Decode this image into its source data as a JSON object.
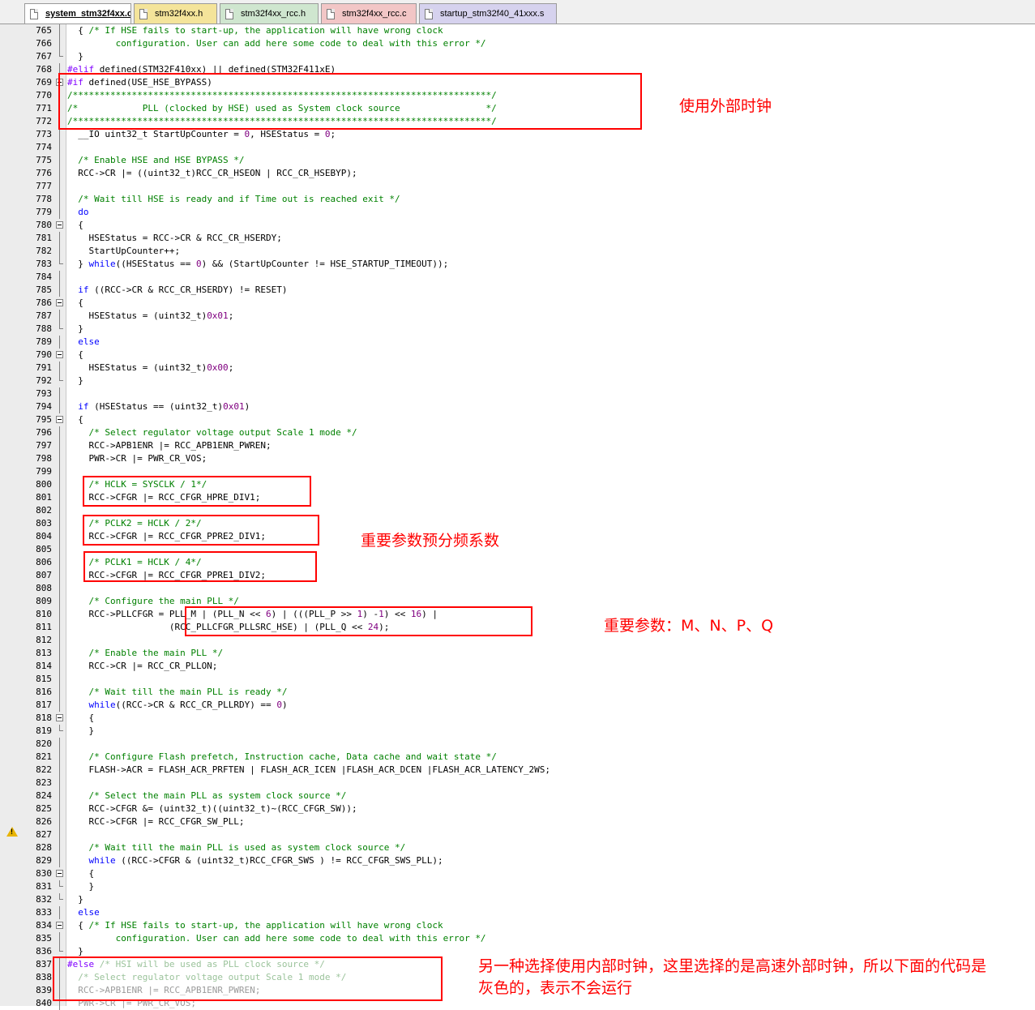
{
  "tabs": [
    {
      "label": "system_stm32f4xx.c",
      "color": "#ffffff",
      "active": true
    },
    {
      "label": "stm32f4xx.h",
      "color": "#f4e49a",
      "active": false
    },
    {
      "label": "stm32f4xx_rcc.h",
      "color": "#cfe6cf",
      "active": false
    },
    {
      "label": "stm32f4xx_rcc.c",
      "color": "#f2c6c6",
      "active": false
    },
    {
      "label": "startup_stm32f40_41xxx.s",
      "color": "#d6d2ee",
      "active": false
    }
  ],
  "code_lines": [
    {
      "num": "765",
      "html": "  { <span class='c'>/* If HSE fails to start-up, the application will have wrong clock</span>"
    },
    {
      "num": "766",
      "html": "<span class='c'>         configuration. User can add here some code to deal with this error */</span>"
    },
    {
      "num": "767",
      "html": "  }"
    },
    {
      "num": "768",
      "html": "<span class='pp'>#elif</span> defined(STM32F410xx) || defined(STM32F411xE)"
    },
    {
      "num": "769",
      "html": "<span class='pp'>#if</span> defined(USE_HSE_BYPASS)"
    },
    {
      "num": "770",
      "html": "<span class='c'>/******************************************************************************/</span>"
    },
    {
      "num": "771",
      "html": "<span class='c'>/*            PLL (clocked by HSE) used as System clock source                */</span>"
    },
    {
      "num": "772",
      "html": "<span class='c'>/******************************************************************************/</span>"
    },
    {
      "num": "773",
      "html": "  __IO uint32_t StartUpCounter = <span class='n'>0</span>, HSEStatus = <span class='n'>0</span>;"
    },
    {
      "num": "774",
      "html": ""
    },
    {
      "num": "775",
      "html": "  <span class='c'>/* Enable HSE and HSE BYPASS */</span>"
    },
    {
      "num": "776",
      "html": "  RCC-&gt;CR |= ((uint32_t)RCC_CR_HSEON | RCC_CR_HSEBYP);"
    },
    {
      "num": "777",
      "html": ""
    },
    {
      "num": "778",
      "html": "  <span class='c'>/* Wait till HSE is ready and if Time out is reached exit */</span>"
    },
    {
      "num": "779",
      "html": "  <span class='k'>do</span>"
    },
    {
      "num": "780",
      "html": "  {"
    },
    {
      "num": "781",
      "html": "    HSEStatus = RCC-&gt;CR &amp; RCC_CR_HSERDY;"
    },
    {
      "num": "782",
      "html": "    StartUpCounter++;"
    },
    {
      "num": "783",
      "html": "  } <span class='k'>while</span>((HSEStatus == <span class='n'>0</span>) &amp;&amp; (StartUpCounter != HSE_STARTUP_TIMEOUT));"
    },
    {
      "num": "784",
      "html": ""
    },
    {
      "num": "785",
      "html": "  <span class='k'>if</span> ((RCC-&gt;CR &amp; RCC_CR_HSERDY) != RESET)"
    },
    {
      "num": "786",
      "html": "  {"
    },
    {
      "num": "787",
      "html": "    HSEStatus = (uint32_t)<span class='n'>0x01</span>;"
    },
    {
      "num": "788",
      "html": "  }"
    },
    {
      "num": "789",
      "html": "  <span class='k'>else</span>"
    },
    {
      "num": "790",
      "html": "  {"
    },
    {
      "num": "791",
      "html": "    HSEStatus = (uint32_t)<span class='n'>0x00</span>;"
    },
    {
      "num": "792",
      "html": "  }"
    },
    {
      "num": "793",
      "html": ""
    },
    {
      "num": "794",
      "html": "  <span class='k'>if</span> (HSEStatus == (uint32_t)<span class='n'>0x01</span>)"
    },
    {
      "num": "795",
      "html": "  {"
    },
    {
      "num": "796",
      "html": "    <span class='c'>/* Select regulator voltage output Scale 1 mode */</span>"
    },
    {
      "num": "797",
      "html": "    RCC-&gt;APB1ENR |= RCC_APB1ENR_PWREN;"
    },
    {
      "num": "798",
      "html": "    PWR-&gt;CR |= PWR_CR_VOS;"
    },
    {
      "num": "799",
      "html": ""
    },
    {
      "num": "800",
      "html": "    <span class='c'>/* HCLK = SYSCLK / 1*/</span>"
    },
    {
      "num": "801",
      "html": "    RCC-&gt;CFGR |= RCC_CFGR_HPRE_DIV1;"
    },
    {
      "num": "802",
      "html": ""
    },
    {
      "num": "803",
      "html": "    <span class='c'>/* PCLK2 = HCLK / 2*/</span>"
    },
    {
      "num": "804",
      "html": "    RCC-&gt;CFGR |= RCC_CFGR_PPRE2_DIV1;"
    },
    {
      "num": "805",
      "html": ""
    },
    {
      "num": "806",
      "html": "    <span class='c'>/* PCLK1 = HCLK / 4*/</span>"
    },
    {
      "num": "807",
      "html": "    RCC-&gt;CFGR |= RCC_CFGR_PPRE1_DIV2;"
    },
    {
      "num": "808",
      "html": ""
    },
    {
      "num": "809",
      "html": "    <span class='c'>/* Configure the main PLL */</span>"
    },
    {
      "num": "810",
      "html": "    RCC-&gt;PLLCFGR = PLL_M | (PLL_N &lt;&lt; <span class='n'>6</span>) | (((PLL_P &gt;&gt; <span class='n'>1</span>) -<span class='n'>1</span>) &lt;&lt; <span class='n'>16</span>) |"
    },
    {
      "num": "811",
      "html": "                   (RCC_PLLCFGR_PLLSRC_HSE) | (PLL_Q &lt;&lt; <span class='n'>24</span>);"
    },
    {
      "num": "812",
      "html": ""
    },
    {
      "num": "813",
      "html": "    <span class='c'>/* Enable the main PLL */</span>"
    },
    {
      "num": "814",
      "html": "    RCC-&gt;CR |= RCC_CR_PLLON;"
    },
    {
      "num": "815",
      "html": ""
    },
    {
      "num": "816",
      "html": "    <span class='c'>/* Wait till the main PLL is ready */</span>"
    },
    {
      "num": "817",
      "html": "    <span class='k'>while</span>((RCC-&gt;CR &amp; RCC_CR_PLLRDY) == <span class='n'>0</span>)"
    },
    {
      "num": "818",
      "html": "    {"
    },
    {
      "num": "819",
      "html": "    }"
    },
    {
      "num": "820",
      "html": ""
    },
    {
      "num": "821",
      "html": "    <span class='c'>/* Configure Flash prefetch, Instruction cache, Data cache and wait state */</span>"
    },
    {
      "num": "822",
      "html": "    FLASH-&gt;ACR = FLASH_ACR_PRFTEN | FLASH_ACR_ICEN |FLASH_ACR_DCEN |FLASH_ACR_LATENCY_2WS;"
    },
    {
      "num": "823",
      "html": ""
    },
    {
      "num": "824",
      "html": "    <span class='c'>/* Select the main PLL as system clock source */</span>"
    },
    {
      "num": "825",
      "html": "    RCC-&gt;CFGR &amp;= (uint32_t)((uint32_t)~(RCC_CFGR_SW));"
    },
    {
      "num": "826",
      "html": "    RCC-&gt;CFGR |= RCC_CFGR_SW_PLL;"
    },
    {
      "num": "827",
      "html": ""
    },
    {
      "num": "828",
      "html": "    <span class='c'>/* Wait till the main PLL is used as system clock source */</span>"
    },
    {
      "num": "829",
      "html": "    <span class='k'>while</span> ((RCC-&gt;CFGR &amp; (uint32_t)RCC_CFGR_SWS ) != RCC_CFGR_SWS_PLL);"
    },
    {
      "num": "830",
      "html": "    {"
    },
    {
      "num": "831",
      "html": "    }"
    },
    {
      "num": "832",
      "html": "  }"
    },
    {
      "num": "833",
      "html": "  <span class='k'>else</span>"
    },
    {
      "num": "834",
      "html": "  { <span class='c'>/* If HSE fails to start-up, the application will have wrong clock</span>"
    },
    {
      "num": "835",
      "html": "<span class='c'>         configuration. User can add here some code to deal with this error */</span>"
    },
    {
      "num": "836",
      "html": "  }"
    },
    {
      "num": "837",
      "html": "<span class='pp'>#else</span> <span class='grc'>/* HSI will be used as PLL clock source */</span>"
    },
    {
      "num": "838",
      "html": "  <span class='grc'>/* Select regulator voltage output Scale 1 mode */</span>"
    },
    {
      "num": "839",
      "html": "<span class='gr'>  RCC-&gt;APB1ENR |= RCC_APB1ENR_PWREN;</span>"
    },
    {
      "num": "840",
      "html": "<span class='gr'>  PWR-&gt;CR |= PWR_CR_VOS;</span>"
    }
  ],
  "annotations": {
    "external_clock": "使用外部时钟",
    "prescaler": "重要参数预分频系数",
    "pll_params": "重要参数：M、N、P、Q",
    "else_note_line1": "另一种选择使用内部时钟，这里选择的是高速外部时钟，所以下面的代码是",
    "else_note_line2": "灰色的，表示不会运行"
  },
  "colors": {
    "annotation": "#ff0000",
    "comment": "#008000",
    "keyword": "#0000ff",
    "number": "#800080",
    "preprocessor": "#8000ff"
  }
}
